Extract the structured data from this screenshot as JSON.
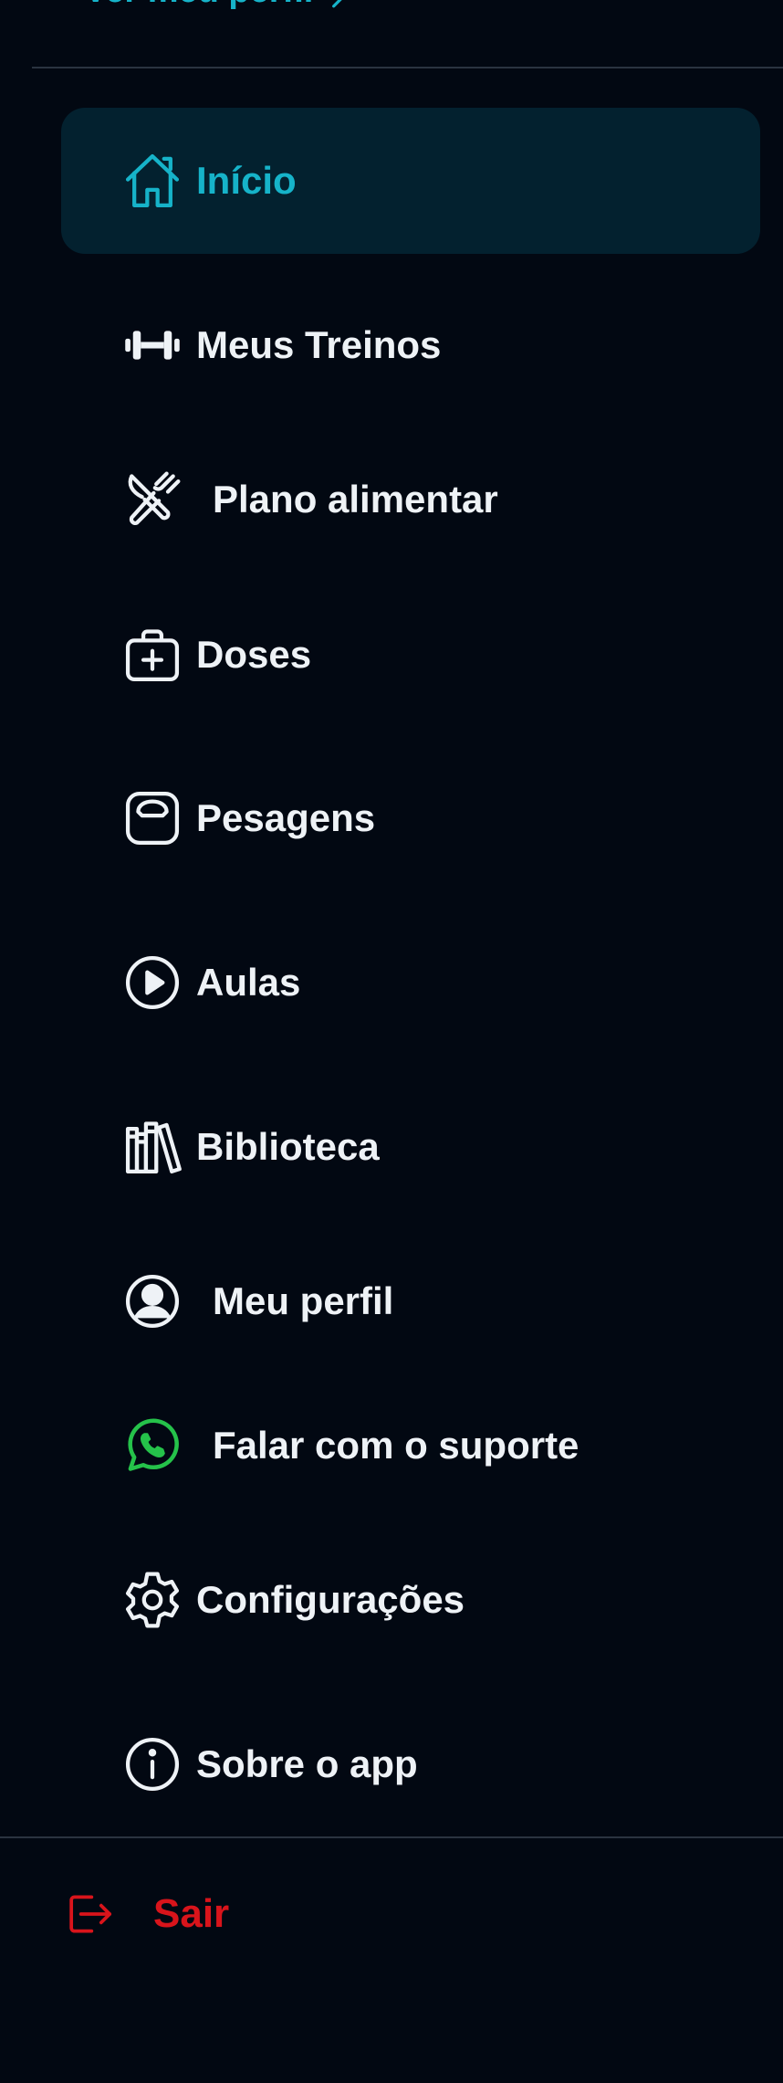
{
  "profile": {
    "link_label": "Ver meu perfil",
    "chevron_icon": "chevron-right-icon"
  },
  "colors": {
    "background": "#020812",
    "accent": "#16b3c9",
    "active_bg": "#03212f",
    "text": "#eef2f6",
    "divider": "#2a3340",
    "whatsapp": "#25c24a",
    "danger": "#d9141b"
  },
  "menu": {
    "items": [
      {
        "label": "Início",
        "icon": "home-icon",
        "active": true
      },
      {
        "label": "Meus Treinos",
        "icon": "dumbbell-icon",
        "active": false
      },
      {
        "label": "Plano alimentar",
        "icon": "fork-knife-icon",
        "active": false
      },
      {
        "label": "Doses",
        "icon": "medical-kit-icon",
        "active": false
      },
      {
        "label": "Pesagens",
        "icon": "scale-icon",
        "active": false
      },
      {
        "label": "Aulas",
        "icon": "play-circle-icon",
        "active": false
      },
      {
        "label": "Biblioteca",
        "icon": "books-icon",
        "active": false
      },
      {
        "label": "Meu perfil",
        "icon": "user-circle-icon",
        "active": false
      },
      {
        "label": "Falar com o suporte",
        "icon": "whatsapp-icon",
        "active": false
      },
      {
        "label": "Configurações",
        "icon": "gear-icon",
        "active": false
      },
      {
        "label": "Sobre o app",
        "icon": "info-icon",
        "active": false
      }
    ]
  },
  "logout": {
    "label": "Sair",
    "icon": "logout-icon"
  }
}
